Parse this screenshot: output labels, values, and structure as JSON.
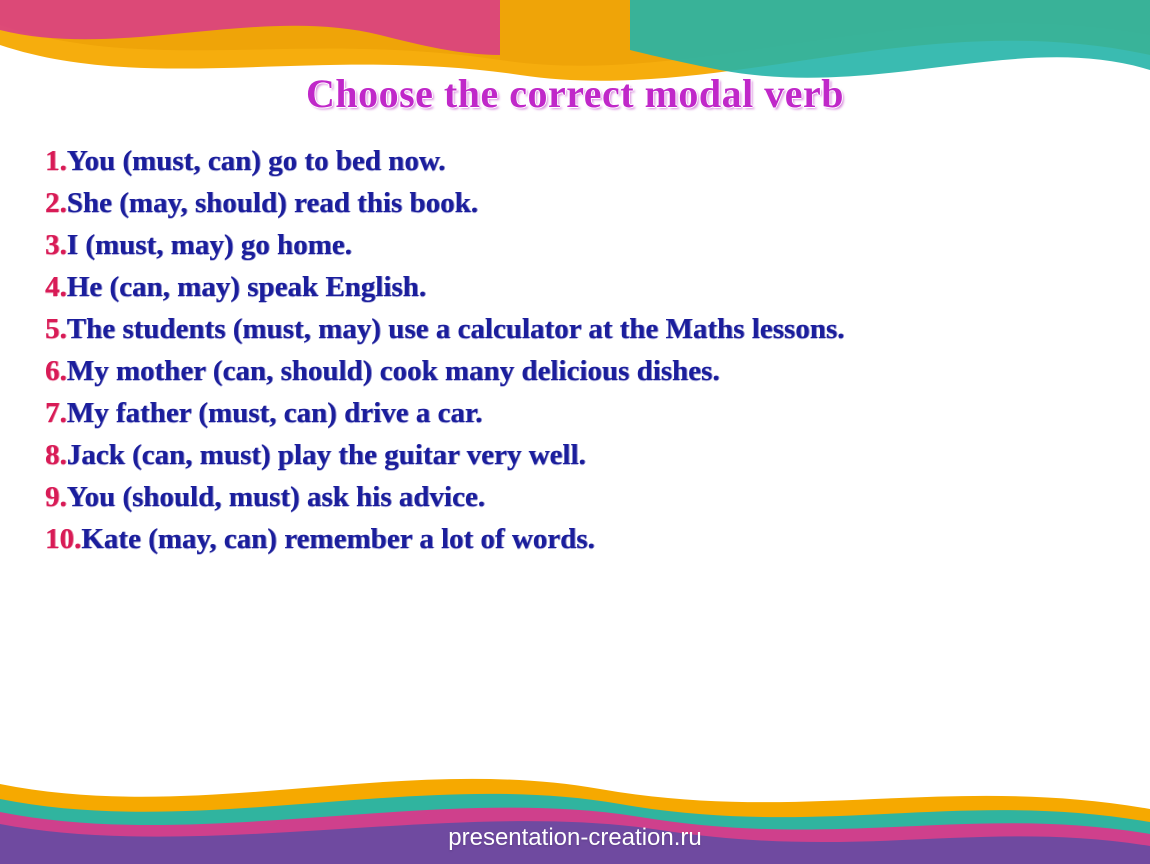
{
  "title": "Choose the correct modal verb",
  "items": [
    {
      "num": "1.",
      "text": "You (must, can) go to bed now."
    },
    {
      "num": "2.",
      "text": "She (may, should) read this book."
    },
    {
      "num": "3.",
      "text": "I (must, may) go home."
    },
    {
      "num": "4.",
      "text": "He (can, may) speak English."
    },
    {
      "num": "5.",
      "text": "The students (must, may) use a calculator at the Maths lessons."
    },
    {
      "num": "6.",
      "text": "My mother (can, should) cook many delicious dishes."
    },
    {
      "num": "7.",
      "text": "My father (must, can) drive a car."
    },
    {
      "num": "8.",
      "text": "Jack (can, must) play the guitar very well."
    },
    {
      "num": "9.",
      "text": "You (should, must) ask his advice."
    },
    {
      "num": "10.",
      "text": "Kate (may, can) remember a lot of words."
    }
  ],
  "footer": "presentation-creation.ru"
}
